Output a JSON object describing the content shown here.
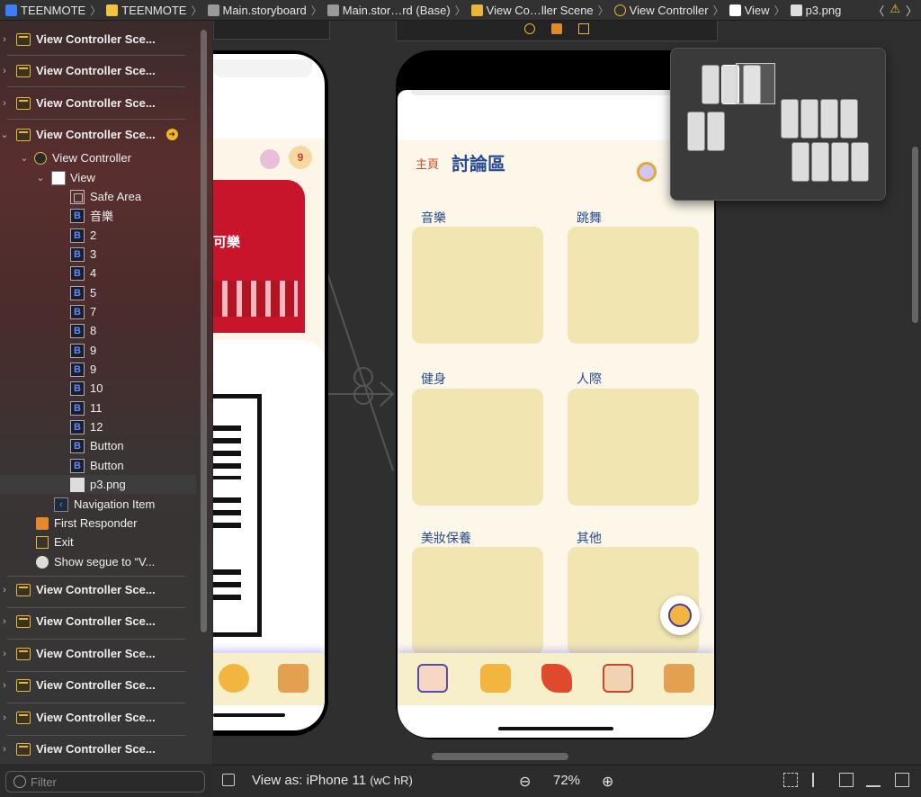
{
  "jumpbar": {
    "crumbs": [
      "TEENMOTE",
      "TEENMOTE",
      "Main.storyboard",
      "Main.stor…rd (Base)",
      "View Co…ller Scene",
      "View Controller",
      "View",
      "p3.png"
    ]
  },
  "sidebar": {
    "scenes_top": [
      "View Controller Sce...",
      "View Controller Sce...",
      "View Controller Sce...",
      "View Controller Sce..."
    ],
    "view_controller": "View Controller",
    "view": "View",
    "children": [
      "Safe Area",
      "音樂",
      "2",
      "3",
      "4",
      "5",
      "7",
      "8",
      "9",
      "9",
      "10",
      "11",
      "12",
      "Button",
      "Button",
      "p3.png"
    ],
    "navigation_item": "Navigation Item",
    "first_responder": "First Responder",
    "exit": "Exit",
    "segue": "Show segue to “V...",
    "scenes_bottom": [
      "View Controller Sce...",
      "View Controller Sce...",
      "View Controller Sce...",
      "View Controller Sce...",
      "View Controller Sce...",
      "View Controller Sce..."
    ],
    "filter_placeholder": "Filter"
  },
  "phone": {
    "home_link": "主頁",
    "title": "討論區",
    "categories": [
      "音樂",
      "跳舞",
      "健身",
      "人際",
      "美妝保養",
      "其他"
    ]
  },
  "left_phone": {
    "banner_text": "可樂",
    "badge": "9"
  },
  "bottombar": {
    "view_as": "View as: iPhone 11",
    "size_class": "(wC hR)",
    "zoom": "72%"
  },
  "colors": {
    "accent_yellow": "#e8b63b",
    "tile": "#f1e6b2",
    "category_blue": "#274a93",
    "home_red": "#d0492a"
  }
}
